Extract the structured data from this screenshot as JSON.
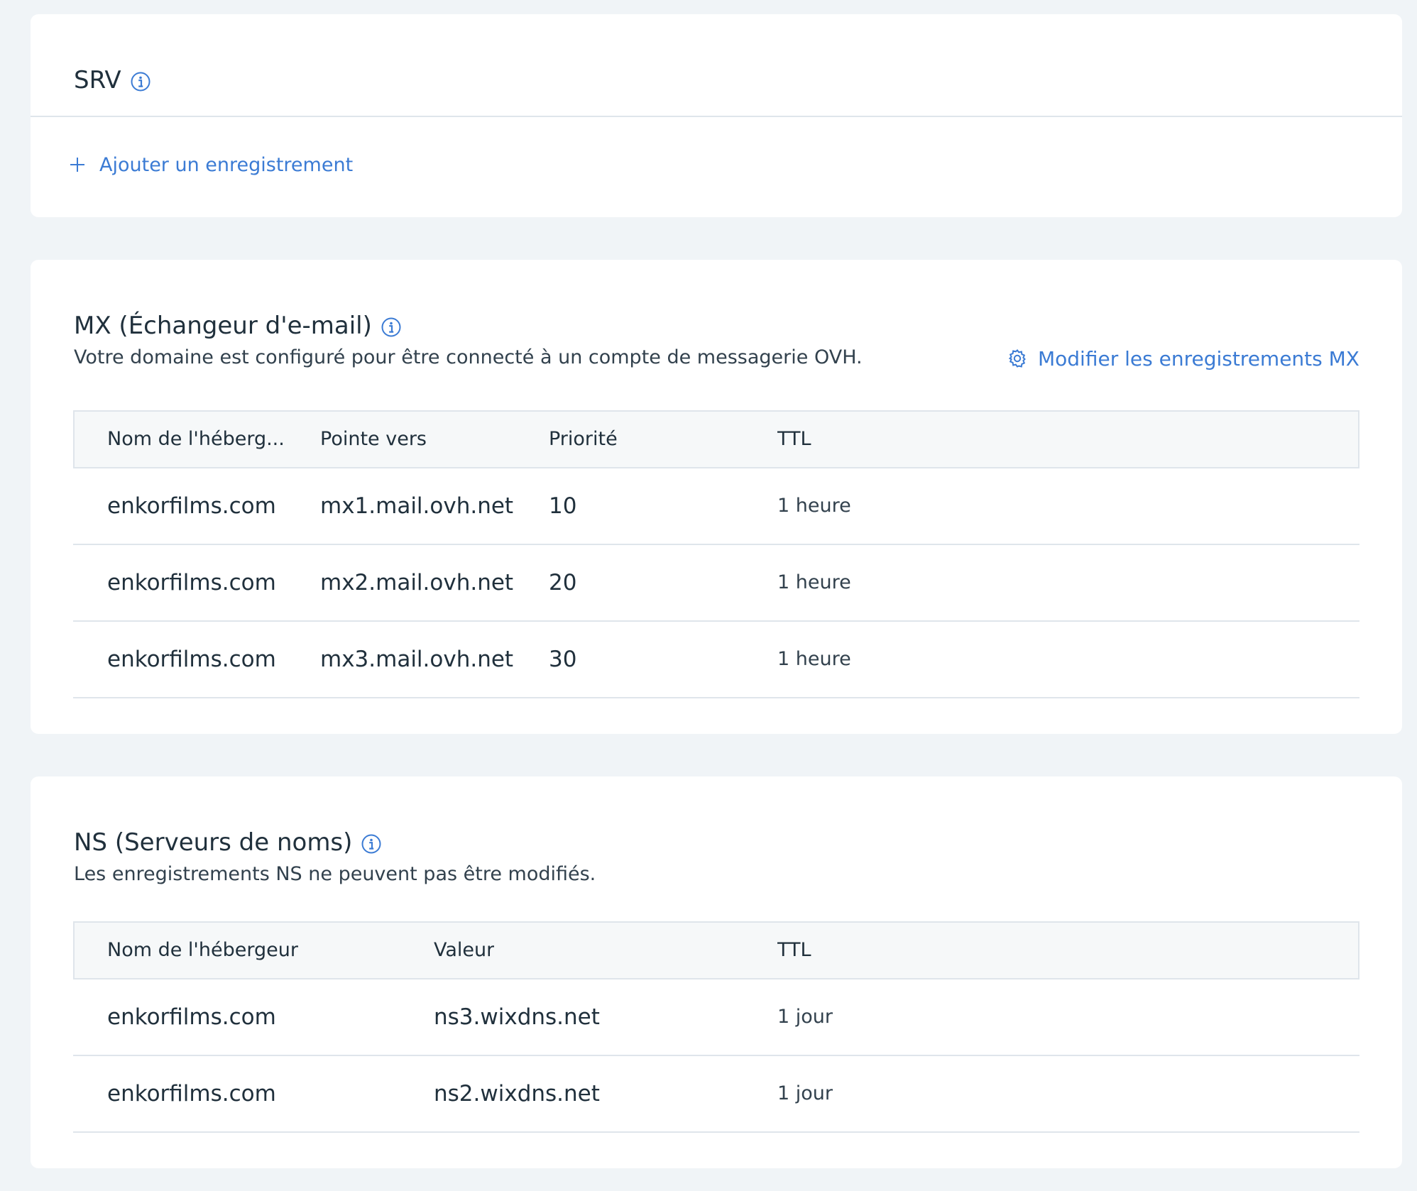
{
  "srv": {
    "title": "SRV",
    "add_label": "Ajouter un enregistrement"
  },
  "mx": {
    "title": "MX (Échangeur d'e-mail)",
    "description": "Votre domaine est configuré pour être connecté à un compte de messagerie OVH.",
    "edit_label": "Modifier les enregistrements MX",
    "columns": [
      "Nom de l'héberg...",
      "Pointe vers",
      "Priorité",
      "TTL"
    ],
    "rows": [
      {
        "host": "enkorfilms.com",
        "target": "mx1.mail.ovh.net",
        "priority": "10",
        "ttl": "1 heure"
      },
      {
        "host": "enkorfilms.com",
        "target": "mx2.mail.ovh.net",
        "priority": "20",
        "ttl": "1 heure"
      },
      {
        "host": "enkorfilms.com",
        "target": "mx3.mail.ovh.net",
        "priority": "30",
        "ttl": "1 heure"
      }
    ]
  },
  "ns": {
    "title": "NS (Serveurs de noms)",
    "description": "Les enregistrements NS ne peuvent pas être modifiés.",
    "columns": [
      "Nom de l'hébergeur",
      "Valeur",
      "TTL"
    ],
    "rows": [
      {
        "host": "enkorfilms.com",
        "value": "ns3.wixdns.net",
        "ttl": "1 jour"
      },
      {
        "host": "enkorfilms.com",
        "value": "ns2.wixdns.net",
        "ttl": "1 jour"
      }
    ]
  },
  "icons": {
    "info": "info-icon",
    "add": "plus-icon",
    "settings": "gear-icon"
  },
  "colors": {
    "background": "#f0f4f7",
    "card": "#ffffff",
    "link": "#3b7bd4",
    "text": "#20303c",
    "divider": "#dfe5eb",
    "table_header": "#f6f8f9"
  }
}
